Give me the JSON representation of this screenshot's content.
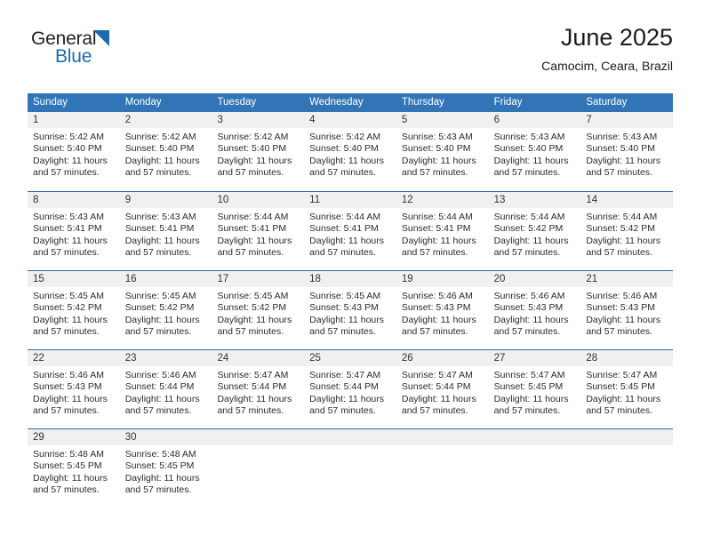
{
  "brand": {
    "name_top": "General",
    "name_bottom": "Blue",
    "triangle_color": "#1c6bb0"
  },
  "header": {
    "title": "June 2025",
    "subtitle": "Camocim, Ceara, Brazil"
  },
  "theme": {
    "header_blue": "#3275b6",
    "row_divider_blue": "#2d6ca8",
    "day_number_bg": "#f0f0f0"
  },
  "weekdays": [
    "Sunday",
    "Monday",
    "Tuesday",
    "Wednesday",
    "Thursday",
    "Friday",
    "Saturday"
  ],
  "weeks": [
    [
      {
        "day": "1",
        "sunrise": "Sunrise: 5:42 AM",
        "sunset": "Sunset: 5:40 PM",
        "daylight": "Daylight: 11 hours and 57 minutes."
      },
      {
        "day": "2",
        "sunrise": "Sunrise: 5:42 AM",
        "sunset": "Sunset: 5:40 PM",
        "daylight": "Daylight: 11 hours and 57 minutes."
      },
      {
        "day": "3",
        "sunrise": "Sunrise: 5:42 AM",
        "sunset": "Sunset: 5:40 PM",
        "daylight": "Daylight: 11 hours and 57 minutes."
      },
      {
        "day": "4",
        "sunrise": "Sunrise: 5:42 AM",
        "sunset": "Sunset: 5:40 PM",
        "daylight": "Daylight: 11 hours and 57 minutes."
      },
      {
        "day": "5",
        "sunrise": "Sunrise: 5:43 AM",
        "sunset": "Sunset: 5:40 PM",
        "daylight": "Daylight: 11 hours and 57 minutes."
      },
      {
        "day": "6",
        "sunrise": "Sunrise: 5:43 AM",
        "sunset": "Sunset: 5:40 PM",
        "daylight": "Daylight: 11 hours and 57 minutes."
      },
      {
        "day": "7",
        "sunrise": "Sunrise: 5:43 AM",
        "sunset": "Sunset: 5:40 PM",
        "daylight": "Daylight: 11 hours and 57 minutes."
      }
    ],
    [
      {
        "day": "8",
        "sunrise": "Sunrise: 5:43 AM",
        "sunset": "Sunset: 5:41 PM",
        "daylight": "Daylight: 11 hours and 57 minutes."
      },
      {
        "day": "9",
        "sunrise": "Sunrise: 5:43 AM",
        "sunset": "Sunset: 5:41 PM",
        "daylight": "Daylight: 11 hours and 57 minutes."
      },
      {
        "day": "10",
        "sunrise": "Sunrise: 5:44 AM",
        "sunset": "Sunset: 5:41 PM",
        "daylight": "Daylight: 11 hours and 57 minutes."
      },
      {
        "day": "11",
        "sunrise": "Sunrise: 5:44 AM",
        "sunset": "Sunset: 5:41 PM",
        "daylight": "Daylight: 11 hours and 57 minutes."
      },
      {
        "day": "12",
        "sunrise": "Sunrise: 5:44 AM",
        "sunset": "Sunset: 5:41 PM",
        "daylight": "Daylight: 11 hours and 57 minutes."
      },
      {
        "day": "13",
        "sunrise": "Sunrise: 5:44 AM",
        "sunset": "Sunset: 5:42 PM",
        "daylight": "Daylight: 11 hours and 57 minutes."
      },
      {
        "day": "14",
        "sunrise": "Sunrise: 5:44 AM",
        "sunset": "Sunset: 5:42 PM",
        "daylight": "Daylight: 11 hours and 57 minutes."
      }
    ],
    [
      {
        "day": "15",
        "sunrise": "Sunrise: 5:45 AM",
        "sunset": "Sunset: 5:42 PM",
        "daylight": "Daylight: 11 hours and 57 minutes."
      },
      {
        "day": "16",
        "sunrise": "Sunrise: 5:45 AM",
        "sunset": "Sunset: 5:42 PM",
        "daylight": "Daylight: 11 hours and 57 minutes."
      },
      {
        "day": "17",
        "sunrise": "Sunrise: 5:45 AM",
        "sunset": "Sunset: 5:42 PM",
        "daylight": "Daylight: 11 hours and 57 minutes."
      },
      {
        "day": "18",
        "sunrise": "Sunrise: 5:45 AM",
        "sunset": "Sunset: 5:43 PM",
        "daylight": "Daylight: 11 hours and 57 minutes."
      },
      {
        "day": "19",
        "sunrise": "Sunrise: 5:46 AM",
        "sunset": "Sunset: 5:43 PM",
        "daylight": "Daylight: 11 hours and 57 minutes."
      },
      {
        "day": "20",
        "sunrise": "Sunrise: 5:46 AM",
        "sunset": "Sunset: 5:43 PM",
        "daylight": "Daylight: 11 hours and 57 minutes."
      },
      {
        "day": "21",
        "sunrise": "Sunrise: 5:46 AM",
        "sunset": "Sunset: 5:43 PM",
        "daylight": "Daylight: 11 hours and 57 minutes."
      }
    ],
    [
      {
        "day": "22",
        "sunrise": "Sunrise: 5:46 AM",
        "sunset": "Sunset: 5:43 PM",
        "daylight": "Daylight: 11 hours and 57 minutes."
      },
      {
        "day": "23",
        "sunrise": "Sunrise: 5:46 AM",
        "sunset": "Sunset: 5:44 PM",
        "daylight": "Daylight: 11 hours and 57 minutes."
      },
      {
        "day": "24",
        "sunrise": "Sunrise: 5:47 AM",
        "sunset": "Sunset: 5:44 PM",
        "daylight": "Daylight: 11 hours and 57 minutes."
      },
      {
        "day": "25",
        "sunrise": "Sunrise: 5:47 AM",
        "sunset": "Sunset: 5:44 PM",
        "daylight": "Daylight: 11 hours and 57 minutes."
      },
      {
        "day": "26",
        "sunrise": "Sunrise: 5:47 AM",
        "sunset": "Sunset: 5:44 PM",
        "daylight": "Daylight: 11 hours and 57 minutes."
      },
      {
        "day": "27",
        "sunrise": "Sunrise: 5:47 AM",
        "sunset": "Sunset: 5:45 PM",
        "daylight": "Daylight: 11 hours and 57 minutes."
      },
      {
        "day": "28",
        "sunrise": "Sunrise: 5:47 AM",
        "sunset": "Sunset: 5:45 PM",
        "daylight": "Daylight: 11 hours and 57 minutes."
      }
    ],
    [
      {
        "day": "29",
        "sunrise": "Sunrise: 5:48 AM",
        "sunset": "Sunset: 5:45 PM",
        "daylight": "Daylight: 11 hours and 57 minutes."
      },
      {
        "day": "30",
        "sunrise": "Sunrise: 5:48 AM",
        "sunset": "Sunset: 5:45 PM",
        "daylight": "Daylight: 11 hours and 57 minutes."
      },
      {
        "day": "",
        "sunrise": "",
        "sunset": "",
        "daylight": ""
      },
      {
        "day": "",
        "sunrise": "",
        "sunset": "",
        "daylight": ""
      },
      {
        "day": "",
        "sunrise": "",
        "sunset": "",
        "daylight": ""
      },
      {
        "day": "",
        "sunrise": "",
        "sunset": "",
        "daylight": ""
      },
      {
        "day": "",
        "sunrise": "",
        "sunset": "",
        "daylight": ""
      }
    ]
  ]
}
